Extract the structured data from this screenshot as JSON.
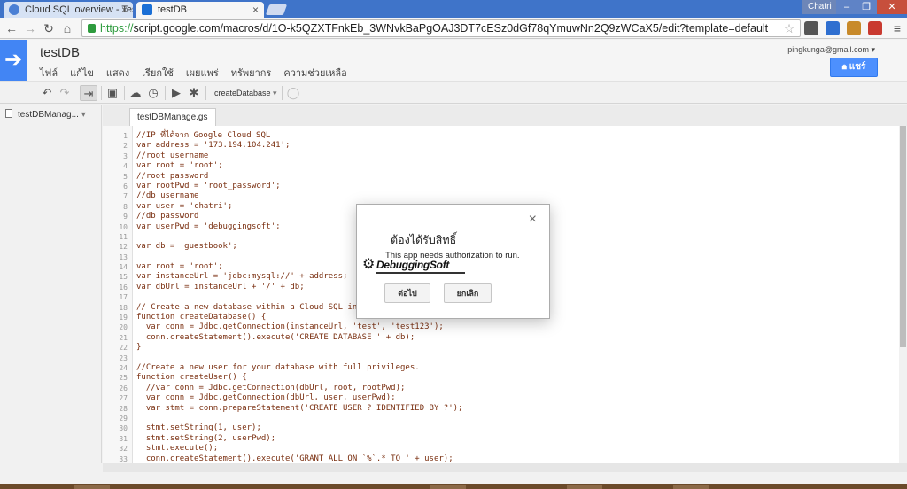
{
  "browser": {
    "tabs": [
      {
        "title": "Cloud SQL overview - Tes"
      },
      {
        "title": "testDB"
      }
    ],
    "user_chip": "Chatri",
    "url_scheme": "https://",
    "url_rest": "script.google.com/macros/d/1O-k5QZXTFnkEb_3WNvkBaPgOAJ3DT7cESz0dGf78qYmuwNn2Q9zWCaX5/edit?template=default"
  },
  "app": {
    "project_title": "testDB",
    "menu": [
      "ไฟล์",
      "แก้ไข",
      "แสดง",
      "เรียกใช้",
      "เผยแพร่",
      "ทรัพยากร",
      "ความช่วยเหลือ"
    ],
    "email": "pingkunga@gmail.com",
    "share_label": "แชร์",
    "function_select": "createDatabase"
  },
  "sidebar": {
    "file_name": "testDBManag..."
  },
  "editor": {
    "tab": "testDBManage.gs",
    "lines": [
      {
        "n": "1",
        "t": "//IP ที่ได้จาก Google Cloud SQL"
      },
      {
        "n": "2",
        "t": "var address = '173.194.104.241';"
      },
      {
        "n": "3",
        "t": "//root username"
      },
      {
        "n": "4",
        "t": "var root = 'root';"
      },
      {
        "n": "5",
        "t": "//root password"
      },
      {
        "n": "6",
        "t": "var rootPwd = 'root_password';"
      },
      {
        "n": "7",
        "t": "//db username"
      },
      {
        "n": "8",
        "t": "var user = 'chatri';"
      },
      {
        "n": "9",
        "t": "//db password"
      },
      {
        "n": "10",
        "t": "var userPwd = 'debuggingsoft';"
      },
      {
        "n": "11",
        "t": ""
      },
      {
        "n": "12",
        "t": "var db = 'guestbook';"
      },
      {
        "n": "13",
        "t": ""
      },
      {
        "n": "14",
        "t": "var root = 'root';"
      },
      {
        "n": "15",
        "t": "var instanceUrl = 'jdbc:mysql://' + address;"
      },
      {
        "n": "16",
        "t": "var dbUrl = instanceUrl + '/' + db;"
      },
      {
        "n": "17",
        "t": ""
      },
      {
        "n": "18",
        "t": "// Create a new database within a Cloud SQL ins"
      },
      {
        "n": "19",
        "t": "function createDatabase() {"
      },
      {
        "n": "20",
        "t": "  var conn = Jdbc.getConnection(instanceUrl, 'test', 'test123');"
      },
      {
        "n": "21",
        "t": "  conn.createStatement().execute('CREATE DATABASE ' + db);"
      },
      {
        "n": "22",
        "t": "}"
      },
      {
        "n": "23",
        "t": ""
      },
      {
        "n": "24",
        "t": "//Create a new user for your database with full privileges."
      },
      {
        "n": "25",
        "t": "function createUser() {"
      },
      {
        "n": "26",
        "t": "  //var conn = Jdbc.getConnection(dbUrl, root, rootPwd);"
      },
      {
        "n": "27",
        "t": "  var conn = Jdbc.getConnection(dbUrl, user, userPwd);"
      },
      {
        "n": "28",
        "t": "  var stmt = conn.prepareStatement('CREATE USER ? IDENTIFIED BY ?');"
      },
      {
        "n": "29",
        "t": ""
      },
      {
        "n": "30",
        "t": "  stmt.setString(1, user);"
      },
      {
        "n": "31",
        "t": "  stmt.setString(2, userPwd);"
      },
      {
        "n": "32",
        "t": "  stmt.execute();"
      },
      {
        "n": "33",
        "t": "  conn.createStatement().execute('GRANT ALL ON `%`.* TO ' + user);"
      }
    ]
  },
  "dialog": {
    "close": "×",
    "title": "ต้องได้รับสิทธิ์",
    "message": "This app needs authorization to run.",
    "watermark": "DebuggingSoft",
    "continue_label": "ต่อไป",
    "cancel_label": "ยกเลิก"
  },
  "colors": {
    "accent": "#4285f4",
    "share": "#4d90fe",
    "code_text": "#7a2f10"
  }
}
